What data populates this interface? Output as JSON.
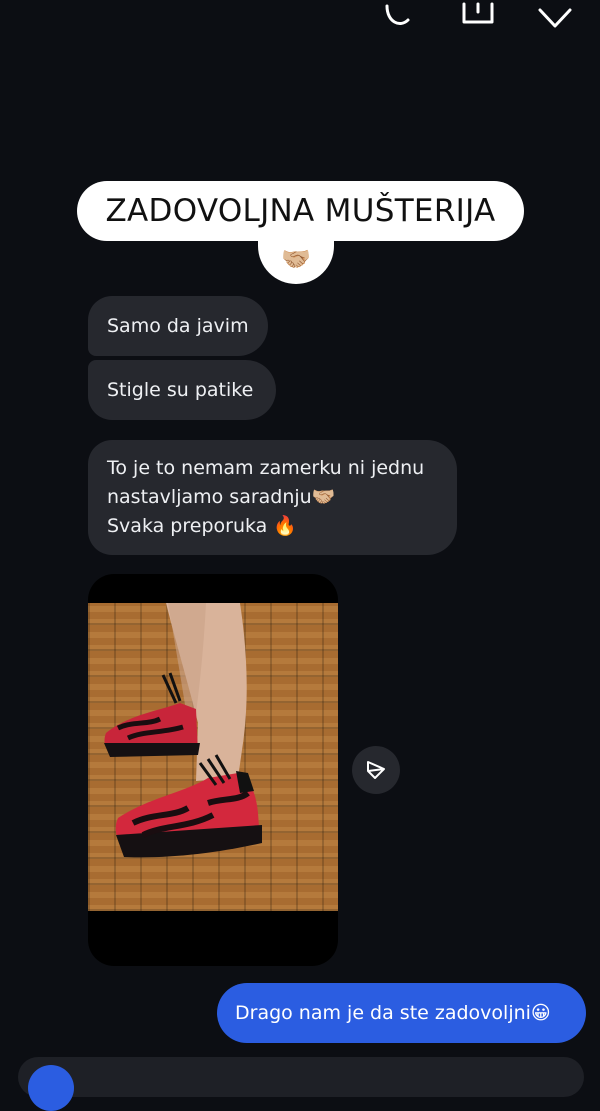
{
  "header": {
    "icons": [
      "link-icon",
      "tray-icon",
      "chevron-down-icon"
    ]
  },
  "banner": {
    "text": "ZADOVOLJNA MUŠTERIJA",
    "reaction_emoji": "🤝🏼"
  },
  "messages": {
    "incoming": [
      {
        "text": "Samo da javim"
      },
      {
        "text": "Stigle su patike"
      },
      {
        "lines": [
          "To je to nemam zamerku ni jednu",
          "nastavljamo saradnju🤝🏼",
          "Svaka preporuka 🔥"
        ]
      }
    ],
    "outgoing": [
      {
        "text": "Drago nam je da ste zadovoljni😀"
      }
    ]
  },
  "photo": {
    "icon": "sneakers-photo"
  },
  "colors": {
    "background": "#0c0e13",
    "incoming_bubble": "#26282e",
    "outgoing_bubble": "#2b5de1",
    "banner": "#ffffff"
  }
}
